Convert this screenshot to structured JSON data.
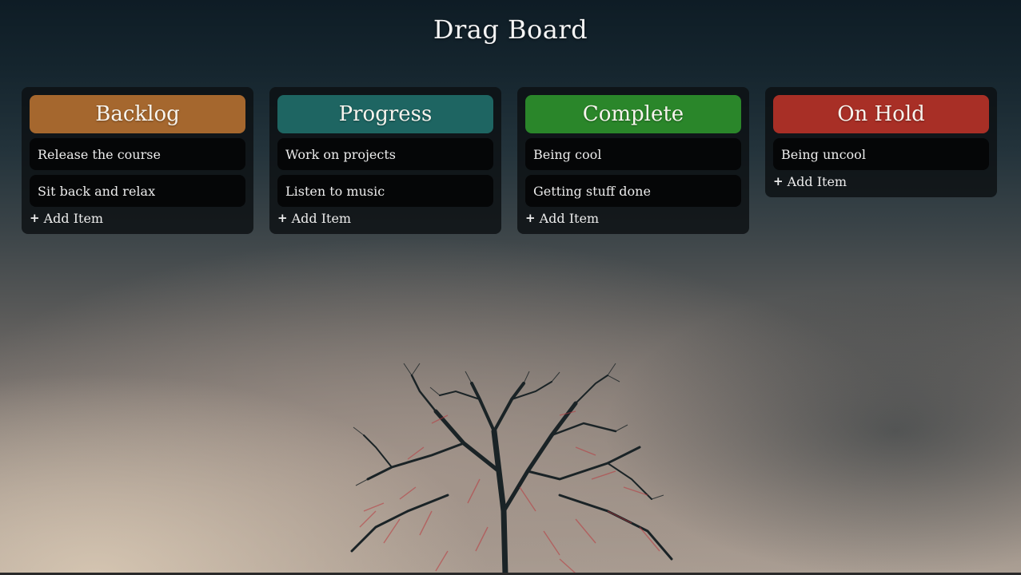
{
  "page": {
    "title": "Drag Board"
  },
  "columns": [
    {
      "name": "Backlog",
      "color": "#a5672e",
      "items": [
        "Release the course",
        "Sit back and relax"
      ],
      "add_label": "Add Item"
    },
    {
      "name": "Progress",
      "color": "#1e6562",
      "items": [
        "Work on projects",
        "Listen to music"
      ],
      "add_label": "Add Item"
    },
    {
      "name": "Complete",
      "color": "#2a862a",
      "items": [
        "Being cool",
        "Getting stuff done"
      ],
      "add_label": "Add Item"
    },
    {
      "name": "On Hold",
      "color": "#a82f26",
      "items": [
        "Being uncool"
      ],
      "add_label": "Add Item"
    }
  ],
  "icons": {
    "add": "plus-icon"
  }
}
